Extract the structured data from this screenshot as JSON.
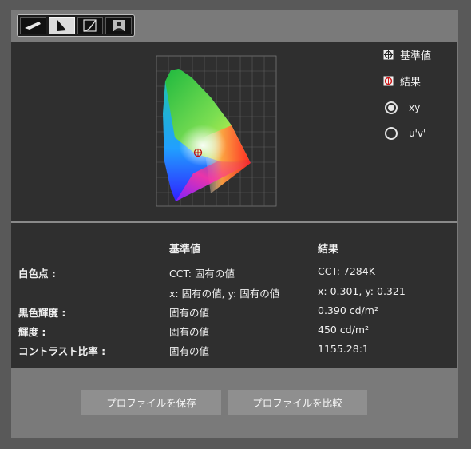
{
  "toolbar": {
    "buttons": [
      {
        "name": "calibration-tab",
        "icon": "monitor-wedge-icon",
        "active": false
      },
      {
        "name": "gamut-tab",
        "icon": "gamut-triangle-icon",
        "active": true
      },
      {
        "name": "gamma-tab",
        "icon": "gamma-curve-icon",
        "active": false
      },
      {
        "name": "portrait-tab",
        "icon": "portrait-icon",
        "active": false
      }
    ]
  },
  "legend": {
    "target_label": "基準値",
    "result_label": "結果",
    "target_icon": "crosshair-square-icon",
    "result_icon": "crosshair-circle-icon",
    "result_color": "#d01818"
  },
  "coords": {
    "options": [
      {
        "label": "xy",
        "selected": true
      },
      {
        "label": "u'v'",
        "selected": false
      }
    ]
  },
  "table": {
    "col_target": "基準値",
    "col_result": "結果",
    "rows": {
      "white_point_label": "白色点 :",
      "cct_target": "CCT: 固有の値",
      "cct_result": "CCT: 7284K",
      "xy_target": "x: 固有の値, y: 固有の値",
      "xy_result": "x: 0.301, y: 0.321",
      "black_label": "黒色輝度 :",
      "black_target": "固有の値",
      "black_result": "0.390 cd/m²",
      "lum_label": "輝度 :",
      "lum_target": "固有の値",
      "lum_result": "450 cd/m²",
      "contrast_label": "コントラスト比率 :",
      "contrast_target": "固有の値",
      "contrast_result": "1155.28:1"
    }
  },
  "buttons": {
    "save": "プロファイルを保存",
    "compare": "プロファイルを比較"
  }
}
